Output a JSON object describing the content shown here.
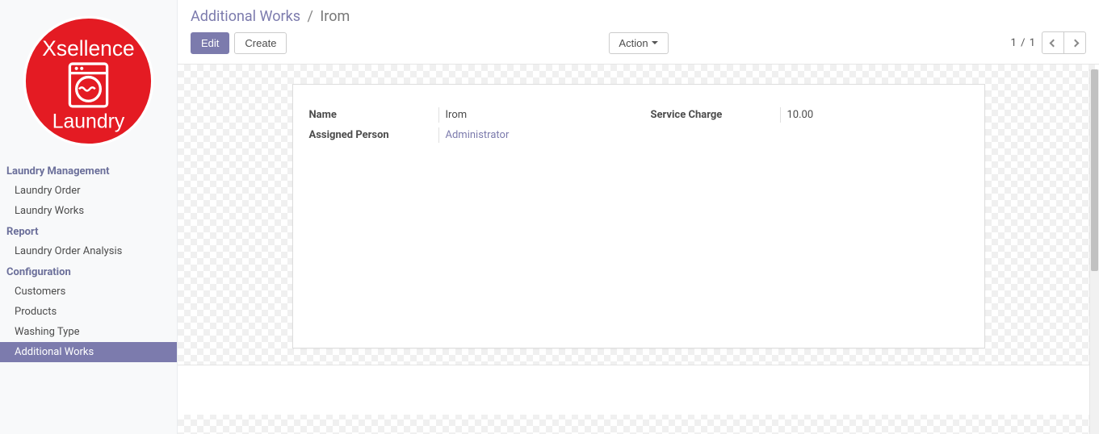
{
  "logo": {
    "top_text": "Xsellence",
    "bottom_text": "Laundry"
  },
  "sidebar": {
    "sections": [
      {
        "header": "Laundry Management",
        "items": [
          {
            "label": "Laundry Order",
            "active": false
          },
          {
            "label": "Laundry Works",
            "active": false
          }
        ]
      },
      {
        "header": "Report",
        "items": [
          {
            "label": "Laundry Order Analysis",
            "active": false
          }
        ]
      },
      {
        "header": "Configuration",
        "items": [
          {
            "label": "Customers",
            "active": false
          },
          {
            "label": "Products",
            "active": false
          },
          {
            "label": "Washing Type",
            "active": false
          },
          {
            "label": "Additional Works",
            "active": true
          }
        ]
      }
    ]
  },
  "breadcrumb": {
    "parent": "Additional Works",
    "separator": "/",
    "current": "Irom"
  },
  "toolbar": {
    "edit_label": "Edit",
    "create_label": "Create",
    "action_label": "Action"
  },
  "pager": {
    "current": "1",
    "separator": "/",
    "total": "1"
  },
  "form": {
    "name_label": "Name",
    "name_value": "Irom",
    "assigned_label": "Assigned Person",
    "assigned_value": "Administrator",
    "charge_label": "Service Charge",
    "charge_value": "10.00"
  }
}
